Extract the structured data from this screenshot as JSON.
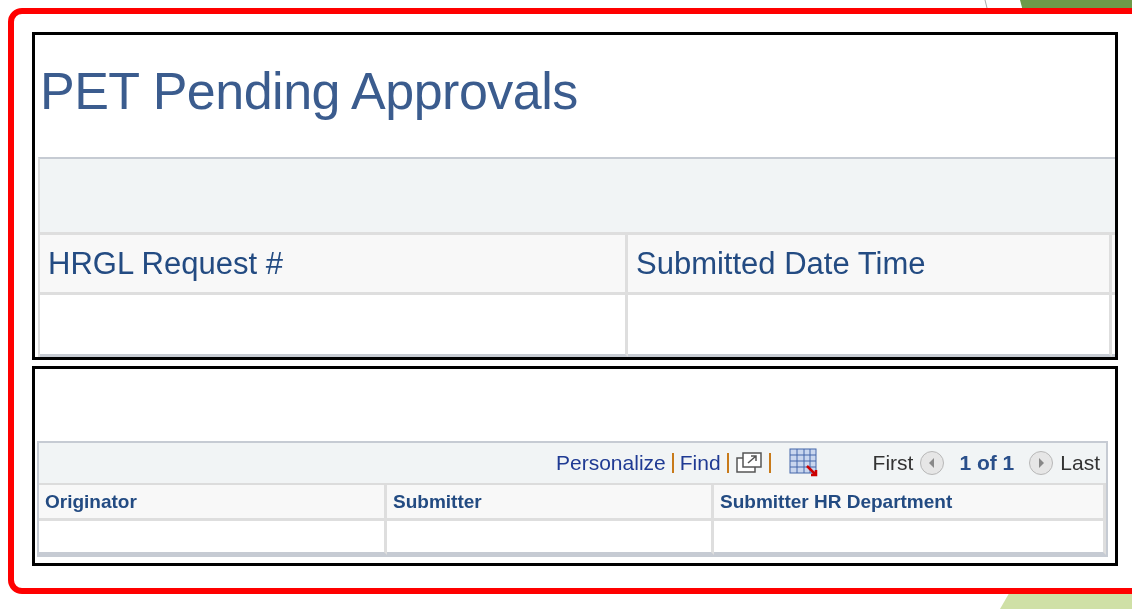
{
  "title": "PET Pending Approvals",
  "requests_grid": {
    "columns": [
      "HRGL Request #",
      "Submitted Date Time"
    ]
  },
  "approvals_grid": {
    "toolbar": {
      "links": [
        "Personalize",
        "Find"
      ],
      "first": "First",
      "range": "1 of 1",
      "last": "Last"
    },
    "columns": [
      "Originator",
      "Submitter",
      "Submitter HR Department"
    ]
  }
}
